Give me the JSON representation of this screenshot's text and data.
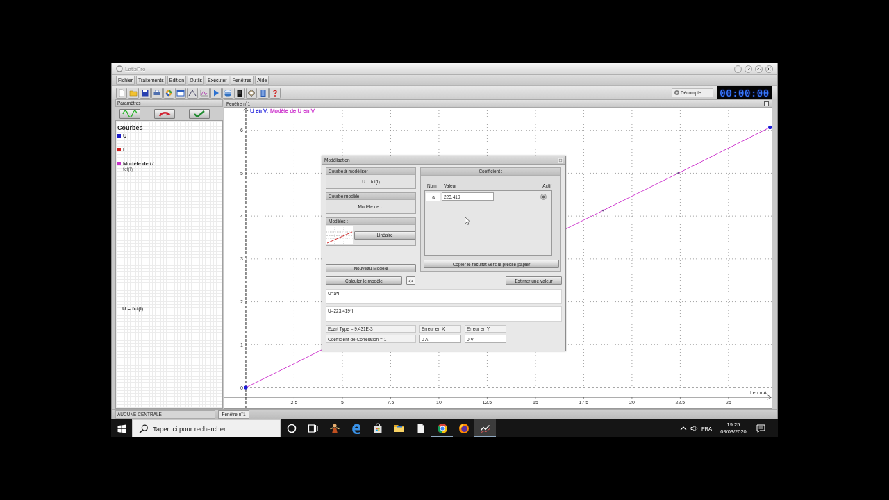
{
  "window": {
    "title": "LatisPro"
  },
  "menu": [
    "Fichier",
    "Traitements",
    "Edition",
    "Outils",
    "Exécuter",
    "Fenêtres",
    "Aide"
  ],
  "toolbar": {
    "countdown": "Décompte",
    "timer": "00:00:00"
  },
  "parameters": {
    "title": "Paramètres"
  },
  "curves": {
    "title": "Courbes",
    "items": [
      {
        "name": "U",
        "color": "#1c1cc8"
      },
      {
        "name": "I",
        "color": "#d42020"
      },
      {
        "name": "Modèle de *U*",
        "color": "#c832c8",
        "subtitle": "fct(I)"
      }
    ]
  },
  "relation": "U = fct(I)",
  "chart_window": {
    "title": "Fenêtre n°1",
    "axis_title": [
      {
        "text": "U en V,",
        "color": "#3a3ae0"
      },
      {
        "text": "Modèle de U en V",
        "color": "#d040d0"
      }
    ],
    "chart_data": {
      "type": "line",
      "xlabel": "I en mA",
      "x": [
        0,
        18.5,
        22.4,
        27.15
      ],
      "series": [
        {
          "color": "#d040d0",
          "values": [
            0,
            4.13,
            5.0,
            6.07
          ]
        }
      ],
      "xlim": [
        -1.15,
        27.27
      ],
      "ylim": [
        0,
        6.53
      ],
      "xticks": [
        2.5,
        5,
        7.5,
        10,
        12.5,
        15,
        17.5,
        20,
        22.5,
        25
      ],
      "yticks": [
        0,
        1,
        2,
        3,
        4,
        5,
        6
      ],
      "grid": true,
      "ref_lines": [
        {
          "axis": "x",
          "value": 0
        }
      ]
    }
  },
  "dialog": {
    "title": "Modélisation",
    "curve_to_model": {
      "title": "Courbe à modéliser",
      "curve": "U",
      "relation": "fct(I)"
    },
    "model_curve": {
      "title": "Courbe modèle",
      "name": "Modèle de U"
    },
    "models": {
      "title": "Modèles :",
      "button": "Linéaire"
    },
    "coefficients": {
      "title": "Coefficient :",
      "columns": [
        "Nom",
        "Valeur",
        "Actif"
      ],
      "rows": [
        {
          "name": "a",
          "value": "223,419"
        }
      ],
      "copy_button": "Copier le résultat vers le presse-papier"
    },
    "new_model_button": "Nouveau Modèle",
    "compute_button": "Calculer le modèle",
    "collapse_button": "<<",
    "estimate_button": "Estimer une valeur",
    "equation": "U=a*I",
    "result": "U=223,419*I",
    "statistics": {
      "std_dev": "Ecart Type = 9,431E-3",
      "correlation": "Coefficient de Corrélation = 1",
      "error_labels": [
        "Erreur en X",
        "Erreur en Y"
      ],
      "errors": [
        "0 A",
        "0 V"
      ]
    }
  },
  "status_bar": {
    "text": "AUCUNE CENTRALE",
    "tabs": [
      {
        "label": "Fenêtre n°1",
        "selected": true
      }
    ]
  },
  "taskbar": {
    "search": {
      "placeholder": "Taper ici pour rechercher"
    },
    "items": [
      {
        "kind": "cortana",
        "running": false,
        "selected": false
      },
      {
        "kind": "task-view",
        "running": false,
        "selected": false
      },
      {
        "kind": "figure",
        "running": false,
        "selected": false
      },
      {
        "kind": "edge",
        "running": false,
        "selected": false
      },
      {
        "kind": "store",
        "running": false,
        "selected": false
      },
      {
        "kind": "explorer",
        "running": false,
        "selected": false
      },
      {
        "kind": "document",
        "running": false,
        "selected": false
      },
      {
        "kind": "chrome",
        "running": true,
        "selected": false
      },
      {
        "kind": "firefox",
        "running": false,
        "selected": false
      },
      {
        "kind": "latispro",
        "running": true,
        "selected": true
      }
    ],
    "language": "FRA",
    "time": "19:25",
    "date": "09/03/2020"
  }
}
